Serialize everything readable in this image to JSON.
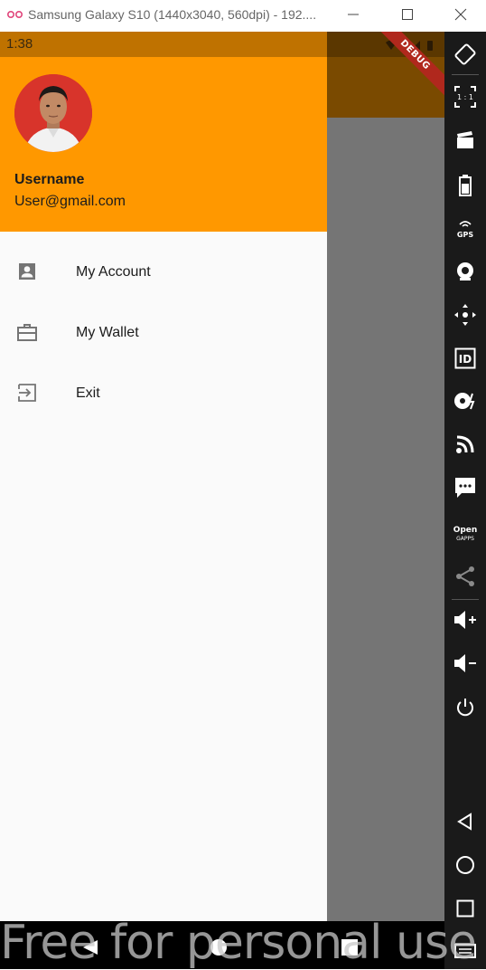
{
  "window": {
    "title": "Samsung Galaxy S10 (1440x3040, 560dpi) - 192...."
  },
  "statusbar": {
    "time": "1:38",
    "debug_label": "DEBUG"
  },
  "drawer": {
    "username": "Username",
    "email": "User@gmail.com",
    "items": [
      {
        "label": "My Account",
        "icon": "account-box-icon"
      },
      {
        "label": "My Wallet",
        "icon": "briefcase-icon"
      },
      {
        "label": "Exit",
        "icon": "exit-icon"
      }
    ]
  },
  "toolbar": {
    "items": [
      "rotate-icon",
      "resize-1-1-icon",
      "clapper-icon",
      "battery-icon",
      "gps-icon",
      "camera-icon",
      "dpad-icon",
      "id-icon",
      "disk-icon",
      "rss-icon",
      "sms-icon",
      "open-gapps-icon",
      "share-icon",
      "volume-up-icon",
      "volume-down-icon",
      "power-icon",
      "back-icon",
      "home-icon",
      "recents-icon",
      "menu-icon"
    ],
    "gps_label": "GPS",
    "ratio_label": "1 : 1",
    "id_label": "ID",
    "open_label": "Open",
    "gapps_label": "GAPPS"
  },
  "watermark": "Free for personal use",
  "colors": {
    "header": "#ff9800",
    "drawer_bg": "#fafafa",
    "scrim": "#757575",
    "toolbar": "#1a1a1a",
    "debug": "#b0281d"
  }
}
